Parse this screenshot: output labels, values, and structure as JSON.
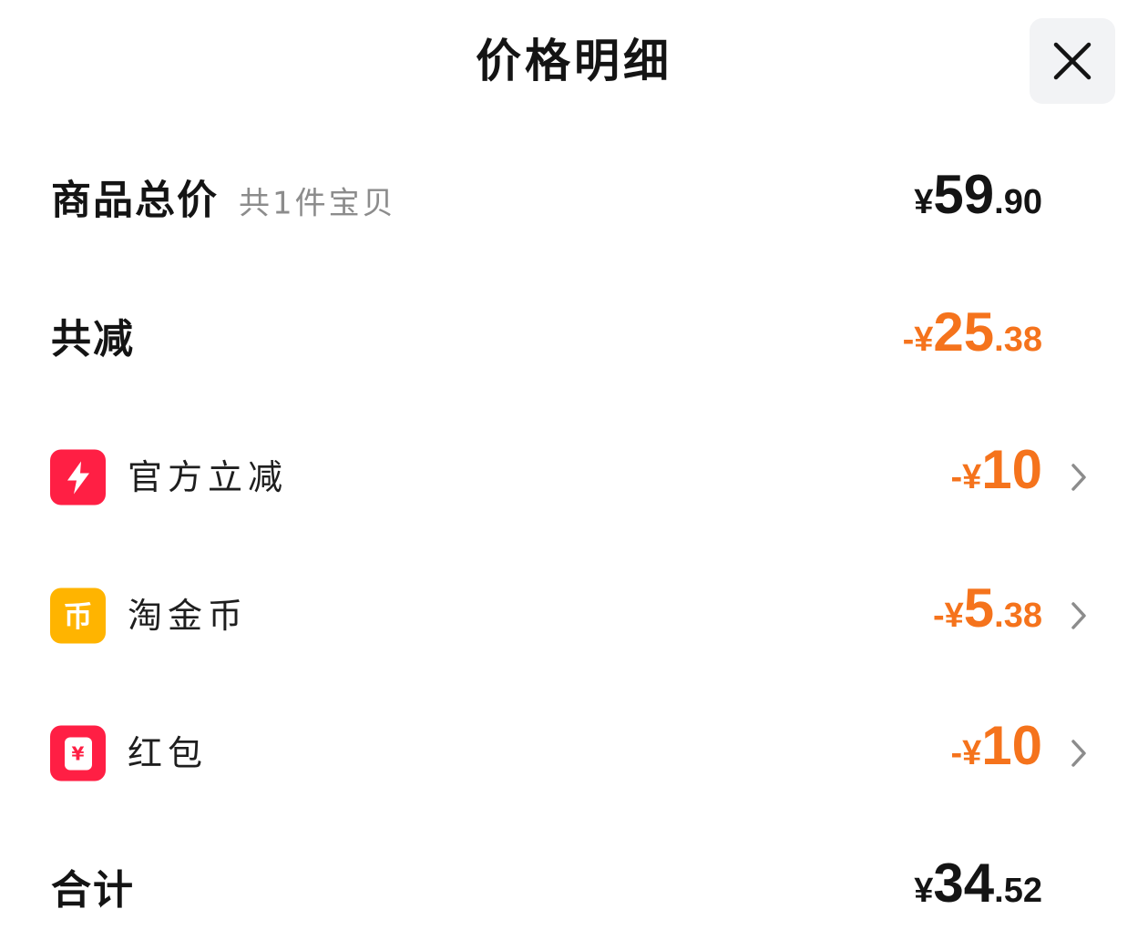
{
  "header": {
    "title": "价格明细"
  },
  "summary": {
    "goods_total": {
      "label": "商品总价",
      "sublabel": "共1件宝贝",
      "currency": "¥",
      "integer": "59",
      "decimal": ".90"
    },
    "total_discount": {
      "label": "共减",
      "prefix": "-¥",
      "integer": "25",
      "decimal": ".38"
    }
  },
  "discounts": [
    {
      "label": "官方立减",
      "icon": "lightning-icon",
      "icon_color": "#ff1f44",
      "prefix": "-¥",
      "integer": "10",
      "decimal": ""
    },
    {
      "label": "淘金币",
      "icon": "coin-icon",
      "icon_color": "#ffb400",
      "icon_glyph": "币",
      "prefix": "-¥",
      "integer": "5",
      "decimal": ".38"
    },
    {
      "label": "红包",
      "icon": "red-packet-icon",
      "icon_color": "#ff1f44",
      "icon_glyph": "¥",
      "prefix": "-¥",
      "integer": "10",
      "decimal": ""
    }
  ],
  "total": {
    "label": "合计",
    "currency": "¥",
    "integer": "34",
    "decimal": ".52"
  },
  "colors": {
    "discount": "#f5731c",
    "text": "#141414",
    "muted": "#8c8c8c",
    "close_bg": "#f2f3f5"
  }
}
